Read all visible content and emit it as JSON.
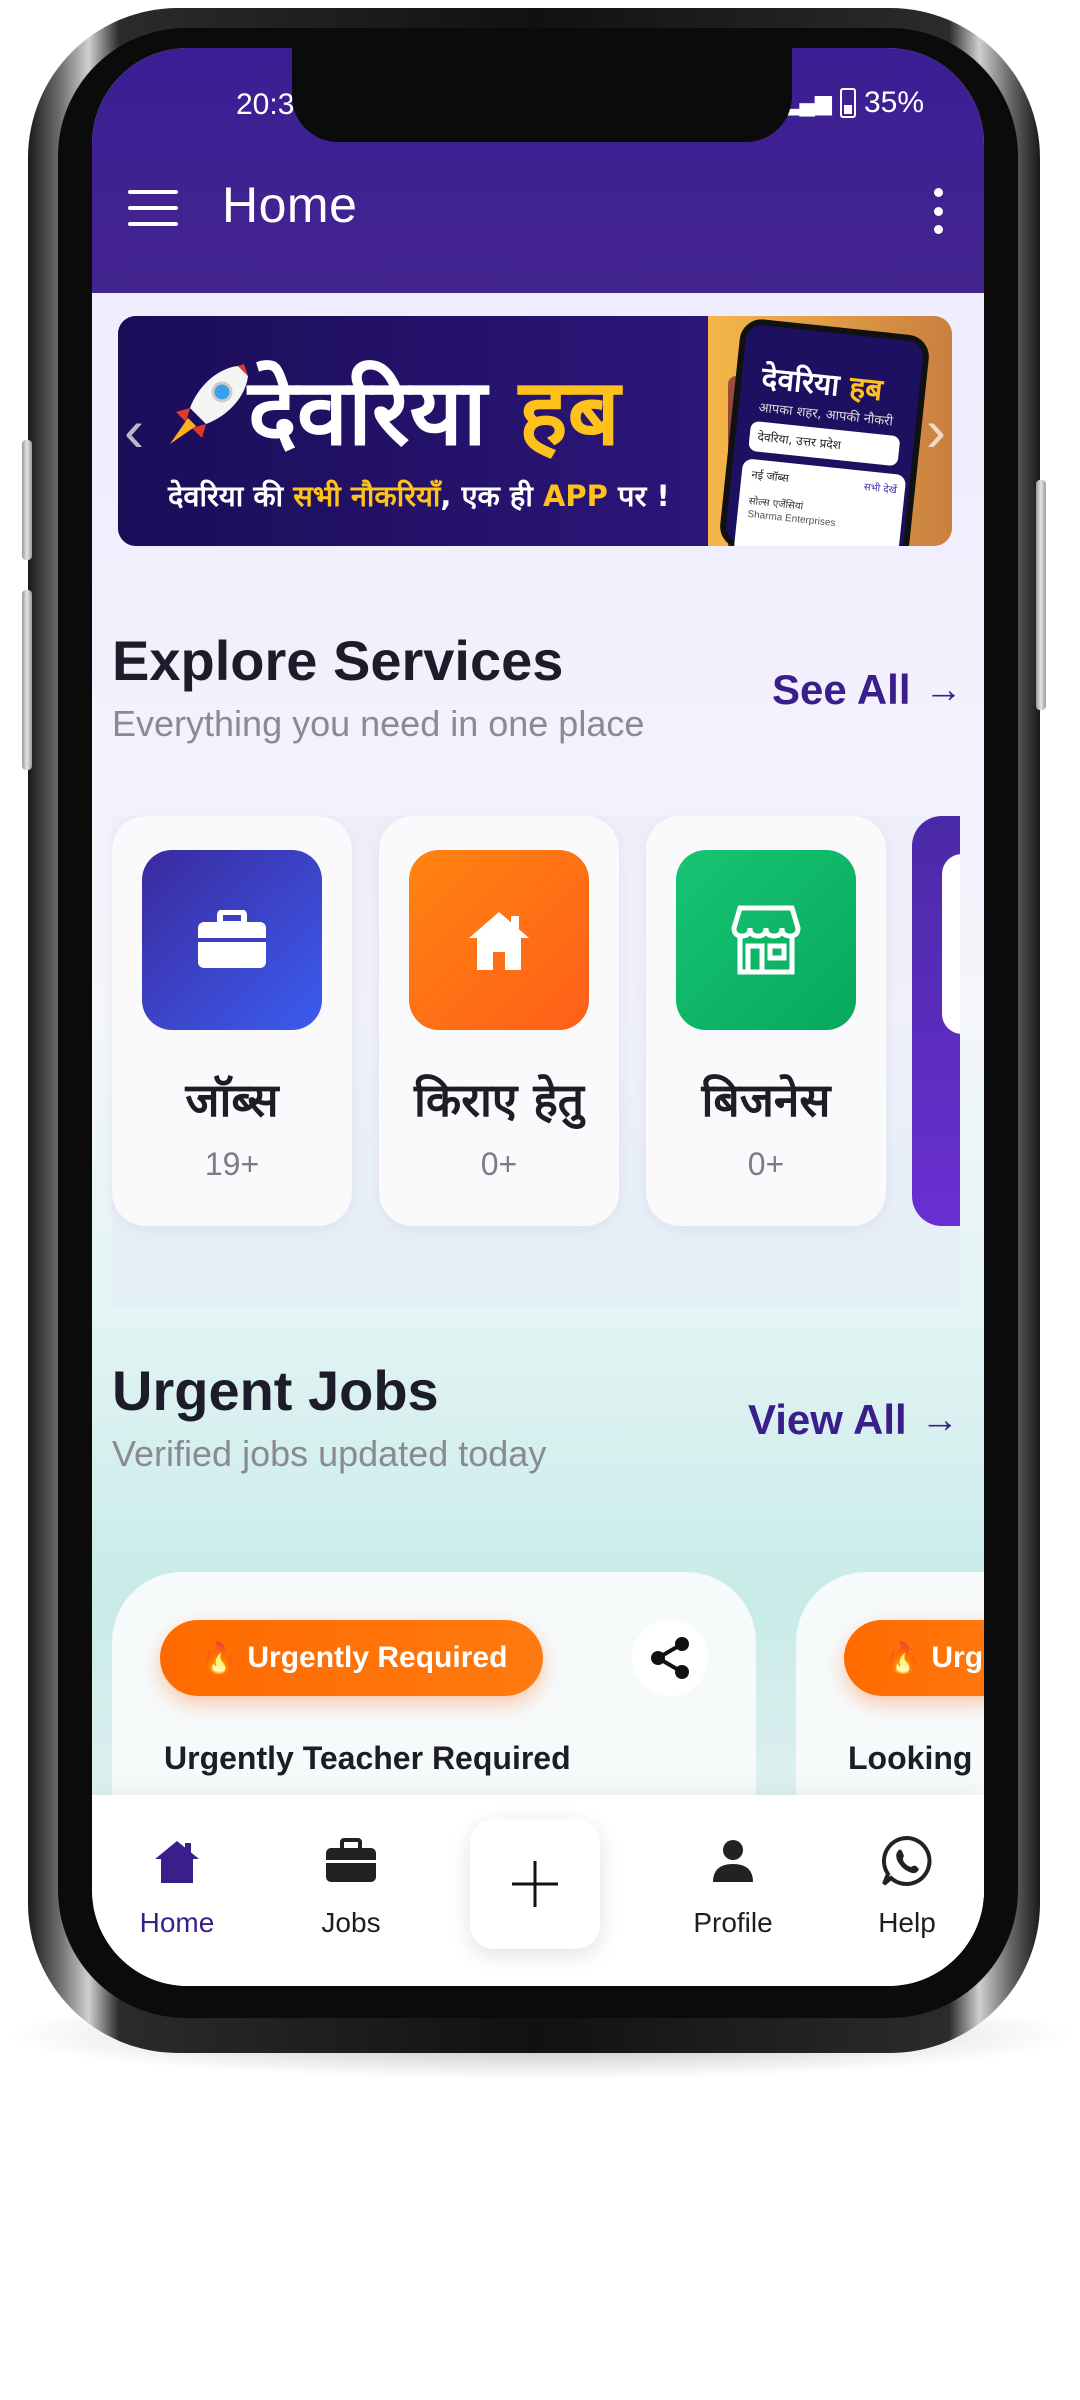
{
  "status_bar": {
    "time": "20:3",
    "signal": "▂▄▆",
    "battery": "35%"
  },
  "app_bar": {
    "title": "Home"
  },
  "banner": {
    "title_main": "देवरिया",
    "title_highlight": "हब",
    "sub_before": "देवरिया की",
    "sub_highlight": "सभी नौकरियाँ",
    "sub_middle": ", एक ही",
    "sub_app": "APP",
    "sub_after": "पर !",
    "phone_title_main": "देवरिया",
    "phone_title_highlight": "हब",
    "phone_sub": "आपका शहर, आपकी नौकरी",
    "phone_location": "देवरिया, उत्तर प्रदेश",
    "phone_card_heading": "नई जॉब्स",
    "phone_card_link": "सभी देखें",
    "phone_card_company": "सोल्स एजेंसियां",
    "phone_card_company_en": "Sharma Enterprises"
  },
  "services": {
    "title": "Explore Services",
    "subtitle": "Everything you need in one place",
    "see_all": "See All",
    "items": [
      {
        "name": "जॉब्स",
        "count": "19+",
        "icon": "briefcase-icon",
        "color": "#3a2fb0"
      },
      {
        "name": "किराए हेतु",
        "count": "0+",
        "icon": "house-icon",
        "color": "#ff7410"
      },
      {
        "name": "बिजनेस",
        "count": "0+",
        "icon": "store-icon",
        "color": "#12b46a"
      }
    ]
  },
  "urgent_jobs": {
    "title": "Urgent Jobs",
    "subtitle": "Verified jobs updated today",
    "view_all": "View All",
    "cards": [
      {
        "badge": "Urgently Required",
        "title": "Urgently Teacher Required"
      },
      {
        "badge": "Urg",
        "title": "Looking"
      }
    ]
  },
  "bottom_nav": {
    "items": [
      {
        "label": "Home",
        "icon": "home-icon",
        "active": true
      },
      {
        "label": "Jobs",
        "icon": "briefcase-icon",
        "active": false
      },
      {
        "label": "Profile",
        "icon": "person-icon",
        "active": false
      },
      {
        "label": "Help",
        "icon": "whatsapp-icon",
        "active": false
      }
    ],
    "add_icon": "plus-icon"
  },
  "colors": {
    "primary": "#3b1e94",
    "accent_orange": "#ff6a00",
    "accent_green": "#12b46a",
    "accent_blue": "#3a2fb0"
  }
}
